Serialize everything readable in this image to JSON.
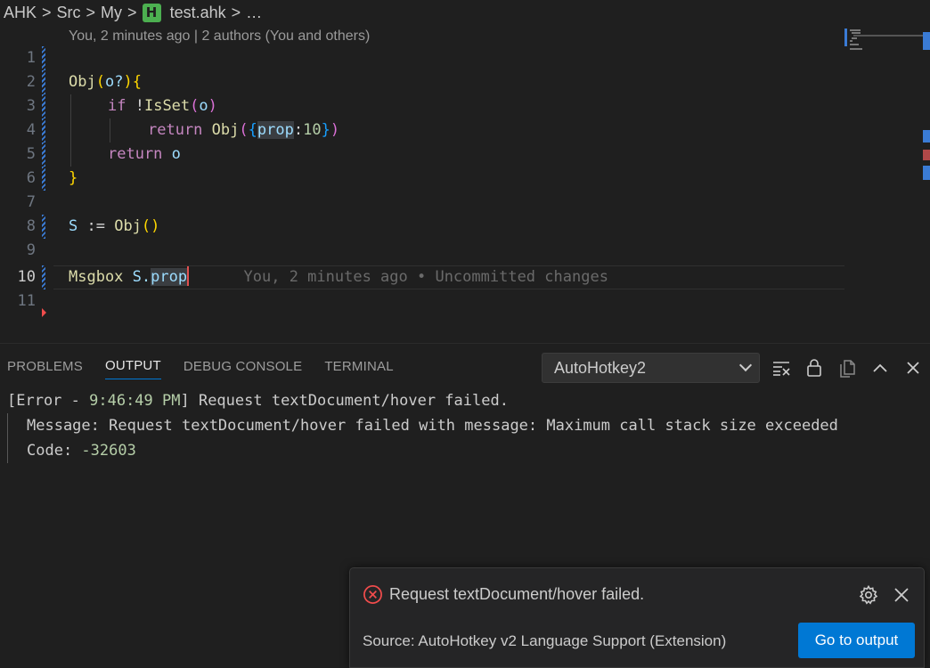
{
  "breadcrumb": {
    "items": [
      "AHK",
      "Src",
      "My"
    ],
    "file_icon_letter": "H",
    "file_name": "test.ahk",
    "trailing": "…"
  },
  "editor": {
    "blame_header": "You, 2 minutes ago | 2 authors (You and others)",
    "line_numbers": [
      "1",
      "2",
      "3",
      "4",
      "5",
      "6",
      "7",
      "8",
      "9",
      "10",
      "11"
    ],
    "active_line": "10",
    "code": {
      "l2": {
        "fn": "Obj",
        "open": "(",
        "param": "o?",
        "close": ")",
        "brace": "{"
      },
      "l3": {
        "kw": "if",
        "not": " !",
        "fn": "IsSet",
        "open": "(",
        "arg": "o",
        "close": ")"
      },
      "l4": {
        "kw": "return",
        "fn": "Obj",
        "open": "(",
        "obrace": "{",
        "prop": "prop",
        "colon": ":",
        "num": "10",
        "cbrace": "}",
        "close": ")"
      },
      "l5": {
        "kw": "return",
        "var": "o"
      },
      "l6": {
        "brace": "}"
      },
      "l8": {
        "var": "S",
        "op": " := ",
        "fn": "Obj",
        "open": "(",
        "close": ")"
      },
      "l10": {
        "fn": "Msgbox",
        "obj": "S.",
        "prop": "prop"
      }
    },
    "inline_blame": "You, 2 minutes ago • Uncommitted changes"
  },
  "panel": {
    "tabs": [
      "PROBLEMS",
      "OUTPUT",
      "DEBUG CONSOLE",
      "TERMINAL"
    ],
    "active_tab": "OUTPUT",
    "channel": "AutoHotkey2",
    "output": {
      "line1_prefix": "[Error - ",
      "line1_time": "9:46:49 PM",
      "line1_rest": "] Request textDocument/hover failed.",
      "line2": "Message: Request textDocument/hover failed with message: Maximum call stack size exceeded",
      "line3_prefix": "Code: ",
      "line3_code": "-32603"
    }
  },
  "notification": {
    "message": "Request textDocument/hover failed.",
    "source": "Source: AutoHotkey v2 Language Support (Extension)",
    "action_label": "Go to output"
  },
  "colors": {
    "accent": "#0078d4",
    "error": "#f14c4c",
    "file_icon": "#4caf50"
  }
}
